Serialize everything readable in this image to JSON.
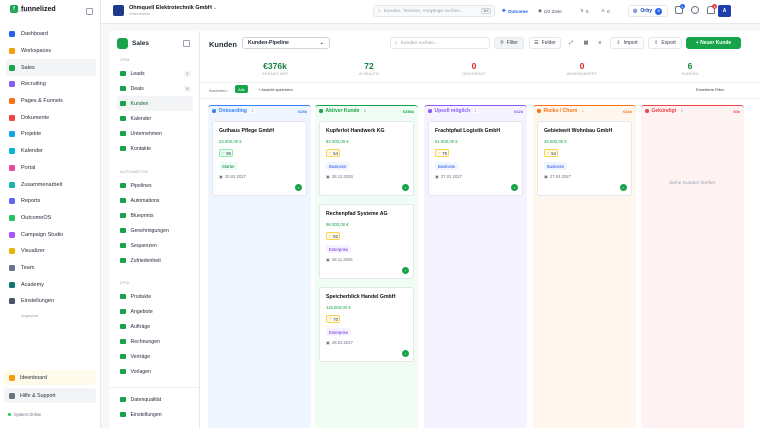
{
  "brand": {
    "name": "funnelized",
    "tagline": "by funnelit.tools"
  },
  "nav": [
    {
      "label": "Dashboard",
      "icon": "grid-icon",
      "color": "#2563eb"
    },
    {
      "label": "Workspaces",
      "icon": "briefcase-icon",
      "color": "#f59e0b"
    },
    {
      "label": "Sales",
      "icon": "sales-icon",
      "color": "#16a34a"
    },
    {
      "label": "Recruiting",
      "icon": "recruiting-icon",
      "color": "#8b5cf6"
    },
    {
      "label": "Pages & Funnels",
      "icon": "funnel-icon",
      "color": "#f97316"
    },
    {
      "label": "Dokumente",
      "icon": "document-icon",
      "color": "#ef4444"
    },
    {
      "label": "Projekte",
      "icon": "project-icon",
      "color": "#0ea5e9"
    },
    {
      "label": "Kalender",
      "icon": "calendar-icon",
      "color": "#06b6d4"
    },
    {
      "label": "Portal",
      "icon": "portal-icon",
      "color": "#ec4899"
    },
    {
      "label": "Zusammenarbeit",
      "icon": "collab-icon",
      "color": "#14b8a6"
    },
    {
      "label": "Reports",
      "icon": "reports-icon",
      "color": "#6366f1"
    },
    {
      "label": "OutcomeOS",
      "icon": "outcome-icon",
      "color": "#22c55e"
    },
    {
      "label": "Campaign Studio",
      "icon": "campaign-icon",
      "color": "#a855f7"
    },
    {
      "label": "Visualizer",
      "icon": "visualizer-icon",
      "color": "#eab308"
    },
    {
      "label": "Team",
      "icon": "team-icon",
      "color": "#64748b"
    },
    {
      "label": "Academy",
      "icon": "academy-icon",
      "color": "#0f766e"
    },
    {
      "label": "Einstellungen",
      "icon": "settings-icon",
      "color": "#475569"
    }
  ],
  "nav_pinned_label": "Angepinnt",
  "bottom": {
    "ideas": "Ideenboard",
    "help": "Hilfe & Support",
    "status": "System Online"
  },
  "top": {
    "org_name": "Ohmquell Elektrotechnik GmbH",
    "org_sub": "Unternehmen",
    "search_placeholder": "Kunden, Termine, Vorgänge suchen...",
    "search_kbd": "⌘K",
    "outcome": "Outcome",
    "goals": "0/2 Ziele",
    "counter_a": "0",
    "counter_b": "0",
    "orby": "Orby",
    "orby_count": "0",
    "badge_1": "3",
    "badge_2": "3",
    "avatar": "A"
  },
  "sales": {
    "title": "Sales",
    "groups": {
      "crm": "CRM",
      "automation": "AUTOMATION",
      "cpq": "CPQ"
    },
    "crm": [
      {
        "label": "Leads",
        "count": "2"
      },
      {
        "label": "Deals",
        "count": "8"
      },
      {
        "label": "Kunden",
        "count": ""
      },
      {
        "label": "Kalender",
        "count": ""
      },
      {
        "label": "Unternehmen",
        "count": ""
      },
      {
        "label": "Kontakte",
        "count": ""
      }
    ],
    "automation": [
      "Pipelines",
      "Automations",
      "Blueprints",
      "Genehmigungen",
      "Sequenzen",
      "Zufriedenheit"
    ],
    "cpq": [
      "Produkte",
      "Angebote",
      "Aufträge",
      "Rechnungen",
      "Verträge",
      "Vorlagen"
    ],
    "footer": [
      "Datenqualität",
      "Einstellungen"
    ]
  },
  "main": {
    "title": "Kunden",
    "pipeline": "Kunden-Pipeline",
    "search_placeholder": "Kunden suchen...",
    "filter": "Filter",
    "fields": "Felder",
    "import": "Import",
    "export": "Export",
    "new": "+ Neuer Kunde",
    "kpis": [
      {
        "value": "€376k",
        "label": "GESAMT-ARR",
        "color": "#15803d"
      },
      {
        "value": "72",
        "label": "Ø HEALTH",
        "color": "#15803d"
      },
      {
        "value": "0",
        "label": "GEKÜNDIGT",
        "color": "#dc2626"
      },
      {
        "value": "0",
        "label": "ABGEWANDERT",
        "color": "#dc2626"
      },
      {
        "value": "6",
        "label": "KUNDEN",
        "color": "#15803d"
      }
    ],
    "views_label": "Ansichten:",
    "view_all": "Alle",
    "save_view": "+ Ansicht speichern",
    "advanced_filter": "Erweiterte Filter",
    "empty_text": "Ziehe Kunden hierher"
  },
  "columns": [
    {
      "name": "Onboarding",
      "count": "1",
      "sum": "€25k",
      "color": "#3b82f6",
      "bg": "#eff6ff",
      "cards": [
        {
          "name": "Guthaus Pflege GmbH",
          "amount": "24.800,00 €",
          "score": "85",
          "tag": "Starter",
          "date": "20.02.2027"
        }
      ]
    },
    {
      "name": "Aktiver Kunde",
      "count": "3",
      "sum": "€256k",
      "color": "#16a34a",
      "bg": "#f0fdf4",
      "cards": [
        {
          "name": "Kupferlot Handwerk KG",
          "amount": "82.000,00 €",
          "score": "54",
          "tag": "Business",
          "date": "28.12.2026"
        },
        {
          "name": "Rechenpfad Systeme AG",
          "amount": "96.000,00 €",
          "score": "82",
          "tag": "Enterprise",
          "date": "28.11.2026"
        },
        {
          "name": "Speicherblick Handel GmbH",
          "amount": "118.000,00 €",
          "score": "70",
          "tag": "Enterprise",
          "date": "28.03.2027"
        }
      ]
    },
    {
      "name": "Upsell möglich",
      "count": "1",
      "sum": "€62k",
      "color": "#8b5cf6",
      "bg": "#f5f3ff",
      "cards": [
        {
          "name": "Frachtpfad Logistik GmbH",
          "amount": "61.500,00 €",
          "score": "79",
          "tag": "Business",
          "date": "27.01.2027"
        }
      ]
    },
    {
      "name": "Risiko / Churn",
      "count": "1",
      "sum": "€34k",
      "color": "#f97316",
      "bg": "#fff7ed",
      "cards": [
        {
          "name": "Gebietweit Wohnbau GmbH",
          "amount": "33.500,00 €",
          "score": "54",
          "tag": "Business",
          "date": "27.04.2027"
        }
      ]
    },
    {
      "name": "Gekündigt",
      "count": "0",
      "sum": "€0k",
      "color": "#ef4444",
      "bg": "#fef2f2",
      "cards": []
    }
  ]
}
